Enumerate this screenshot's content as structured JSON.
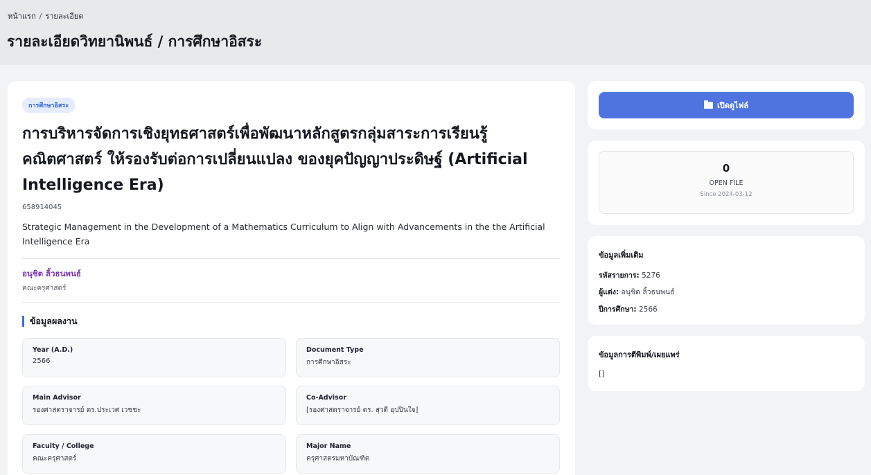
{
  "breadcrumb": {
    "home": "หน้าแรก",
    "separator": "/",
    "current": "รายละเอียด"
  },
  "page_title": "รายละเอียดวิทยานิพนธ์ / การศึกษาอิสระ",
  "thesis": {
    "badge": "การศึกษาอิสระ",
    "title": "การบริหารจัดการเชิงยุทธศาสตร์เพื่อพัฒนาหลักสูตรกลุ่มสาระการเรียนรู้คณิตศาสตร์ ให้รองรับต่อการเปลี่ยนแปลง ของยุคปัญญาประดิษฐ์ (Artificial Intelligence Era)",
    "student_id": "658914045",
    "title_en": "Strategic Management in the Development of a Mathematics Curriculum to Align with Advancements in the the Artificial Intelligence Era",
    "author_name": "อนุชิต ลิ้วธนพนธ์",
    "author_faculty": "คณะครุศาสตร์"
  },
  "section_title": "ข้อมูลผลงาน",
  "fields": [
    {
      "label": "Year (A.D.)",
      "value": "2566"
    },
    {
      "label": "Document Type",
      "value": "การศึกษาอิสระ"
    },
    {
      "label": "Main Advisor",
      "value": "รองศาสตราจารย์ ดร.ประเวศ เวชชะ"
    },
    {
      "label": "Co-Advisor",
      "value": "[รองศาสตราจารย์ ดร. สุวดี อุปปินใจ]"
    },
    {
      "label": "Faculty / College",
      "value": "คณะครุศาสตร์"
    },
    {
      "label": "Major Name",
      "value": "ครุศาสตรมหาบัณฑิต"
    }
  ],
  "file": {
    "open_button": "เปิดดูไฟล์",
    "icon": "folder-open-icon"
  },
  "stats": {
    "count": "0",
    "label": "OPEN FILE",
    "since": "Since 2024-03-12"
  },
  "info": {
    "heading": "ข้อมูลเพิ่มเติม",
    "item_code_label": "รหัสรายการ:",
    "item_code": "5276",
    "author_label": "ผู้แต่ง:",
    "author": "อนุชิต ลิ้วธนพนธ์",
    "year_label": "ปีการศึกษา:",
    "year": "2566"
  },
  "publication": {
    "heading": "ข้อมูลการตีพิมพ์/เผยแพร่",
    "value": "[]"
  },
  "colors": {
    "accent": "#4f74e0",
    "author": "#7b32b8",
    "badge_bg": "#e5edfd"
  }
}
